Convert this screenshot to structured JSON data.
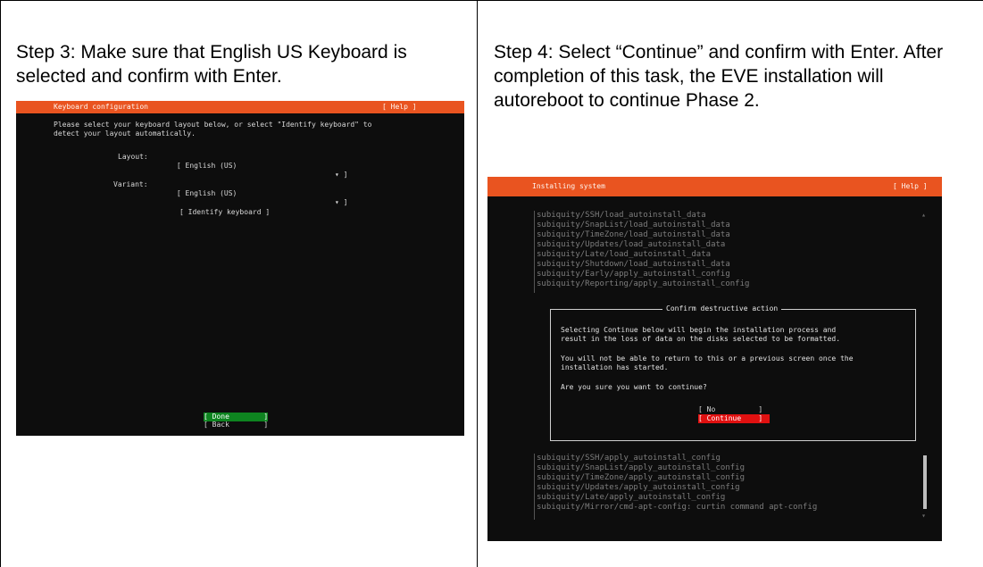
{
  "step3": {
    "text": "Step 3: Make sure that English US Keyboard is selected and confirm with Enter.",
    "screen": {
      "title": "Keyboard configuration",
      "help": "[ Help ]",
      "instructions": "Please select your keyboard layout below, or select \"Identify keyboard\" to\ndetect your layout automatically.",
      "layout_label": "Layout:",
      "layout_value": "[ English (US)",
      "layout_arrow": "▾ ]",
      "variant_label": "Variant:",
      "variant_value": "[ English (US)",
      "variant_arrow": "▾ ]",
      "identify_button": "[ Identify keyboard ]",
      "done_button": "[ Done        ]",
      "back_button": "[ Back        ]"
    }
  },
  "step4": {
    "text": "Step 4: Select “Continue” and confirm with Enter. After completion of this task, the EVE installation will autoreboot to continue Phase 2.",
    "screen": {
      "title": "Installing system",
      "help": "[ Help ]",
      "log_top": [
        "subiquity/SSH/load_autoinstall_data",
        "subiquity/SnapList/load_autoinstall_data",
        "subiquity/TimeZone/load_autoinstall_data",
        "subiquity/Updates/load_autoinstall_data",
        "subiquity/Late/load_autoinstall_data",
        "subiquity/Shutdown/load_autoinstall_data",
        "subiquity/Early/apply_autoinstall_config",
        "subiquity/Reporting/apply_autoinstall_config"
      ],
      "dialog_title": "Confirm destructive action",
      "dialog_p1": "Selecting Continue below will begin the installation process and\nresult in the loss of data on the disks selected to be formatted.",
      "dialog_p2": "You will not be able to return to this or a previous screen once the\ninstallation has started.",
      "dialog_question": "Are you sure you want to continue?",
      "no_button": "[ No          ]",
      "continue_button": "[ Continue    ]",
      "log_bottom": [
        "subiquity/SSH/apply_autoinstall_config",
        "subiquity/SnapList/apply_autoinstall_config",
        "subiquity/TimeZone/apply_autoinstall_config",
        "subiquity/Updates/apply_autoinstall_config",
        "subiquity/Late/apply_autoinstall_config",
        "subiquity/Mirror/cmd-apt-config: curtin command apt-config"
      ]
    }
  }
}
